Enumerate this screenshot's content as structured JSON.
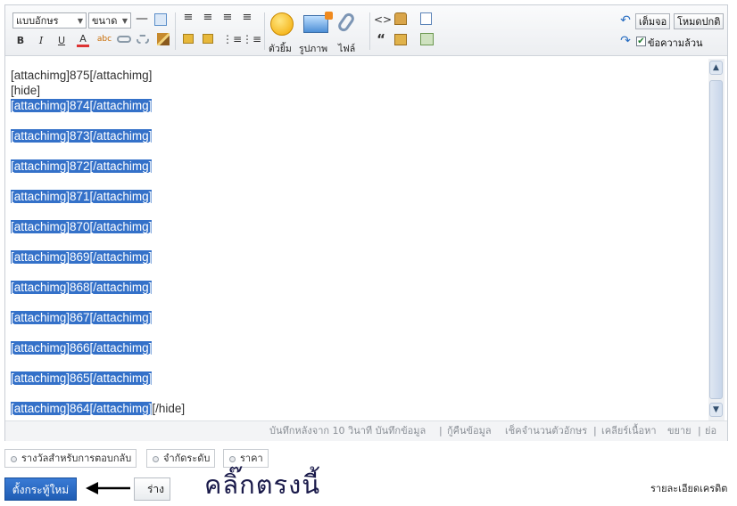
{
  "toolbar": {
    "font_select": "แบบอักษร",
    "size_select": "ขนาด",
    "emoticon_label": "ตัวยิ้ม",
    "image_label": "รูปภาพ",
    "file_label": "ไฟล์",
    "fullscreen_label": "เต็มจอ",
    "normal_mode_label": "โหมดปกติ",
    "plain_text_label": "ข้อความล้วน",
    "plain_text_checked": true
  },
  "content": {
    "lines": [
      {
        "text": "[attachimg]875[/attachimg]",
        "highlight": false
      },
      {
        "text": "[hide]",
        "highlight": false
      },
      {
        "text": "[attachimg]874[/attachimg]",
        "highlight": true
      },
      {
        "text": "[attachimg]873[/attachimg]",
        "highlight": true
      },
      {
        "text": "[attachimg]872[/attachimg]",
        "highlight": true
      },
      {
        "text": "[attachimg]871[/attachimg]",
        "highlight": true
      },
      {
        "text": "[attachimg]870[/attachimg]",
        "highlight": true
      },
      {
        "text": "[attachimg]869[/attachimg]",
        "highlight": true
      },
      {
        "text": "[attachimg]868[/attachimg]",
        "highlight": true
      },
      {
        "text": "[attachimg]867[/attachimg]",
        "highlight": true
      },
      {
        "text": "[attachimg]866[/attachimg]",
        "highlight": true
      },
      {
        "text": "[attachimg]865[/attachimg]",
        "highlight": true
      },
      {
        "text": "[attachimg]864[/attachimg]",
        "highlight": true
      }
    ],
    "trailing_text": "[/hide]"
  },
  "status": {
    "autosave": "บันทึกหลังจาก 10 วินาที บันทึกข้อมูล",
    "recover": "กู้คืนข้อมูล",
    "char_count": "เช็คจำนวนตัวอักษร",
    "clear": "เคลียร์เนื้อหา",
    "expand": "ขยาย",
    "shrink": "ย่อ"
  },
  "options": [
    "รางวัลสำหรับการตอบกลับ",
    "จำกัดระดับ",
    "ราคา"
  ],
  "actions": {
    "new_thread": "ตั้งกระทู้ใหม่",
    "draft": "ร่าง",
    "annotation": "คลิ๊กตรงนี้",
    "credit_details": "รายละเอียดเครดิต"
  },
  "colors": {
    "selection": "#3471c9",
    "primary_button": "#2a6cc8"
  }
}
